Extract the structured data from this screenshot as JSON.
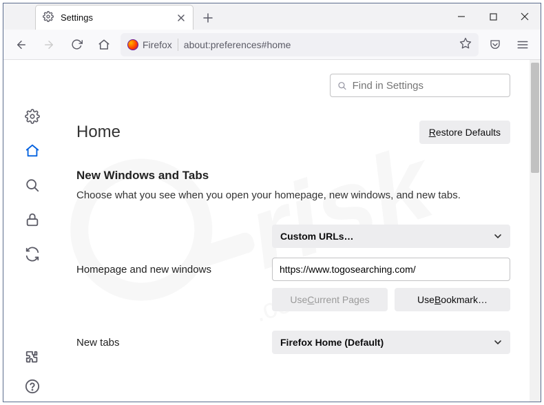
{
  "tab": {
    "title": "Settings"
  },
  "address": {
    "identity": "Firefox",
    "url": "about:preferences#home"
  },
  "search": {
    "placeholder": "Find in Settings"
  },
  "page": {
    "title": "Home",
    "restore_label": "Restore Defaults"
  },
  "section": {
    "heading": "New Windows and Tabs",
    "desc": "Choose what you see when you open your homepage, new windows, and new tabs."
  },
  "homepage": {
    "label": "Homepage and new windows",
    "dropdown": "Custom URLs…",
    "url_value": "https://www.togosearching.com/",
    "use_current_prefix": "Use ",
    "use_current_u": "C",
    "use_current_suffix": "urrent Pages",
    "use_bookmark_prefix": "Use ",
    "use_bookmark_u": "B",
    "use_bookmark_suffix": "ookmark…"
  },
  "newtabs": {
    "label": "New tabs",
    "dropdown": "Firefox Home (Default)"
  }
}
